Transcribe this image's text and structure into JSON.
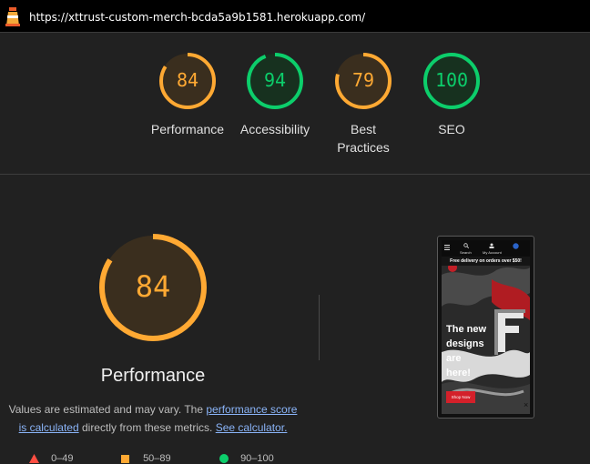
{
  "topbar": {
    "url": "https://xttrust-custom-merch-bcda5a9b1581.herokuapp.com/"
  },
  "colors": {
    "average": "#ffa933",
    "good": "#0cce6b",
    "poor": "#ff4e42"
  },
  "gauges": [
    {
      "score": "84",
      "label": "Performance",
      "status": "average"
    },
    {
      "score": "94",
      "label": "Accessibility",
      "status": "good"
    },
    {
      "score": "79",
      "label_line1": "Best",
      "label_line2": "Practices",
      "status": "average"
    },
    {
      "score": "100",
      "label": "SEO",
      "status": "good"
    }
  ],
  "main": {
    "score": "84",
    "title": "Performance",
    "note_prefix": "Values are estimated and may vary. The ",
    "note_link1_a": "performance score",
    "note_link1_b": "is calculated",
    "note_middle": " directly from these metrics. ",
    "note_link2": "See calculator."
  },
  "legend": [
    {
      "range": "0–49",
      "shape": "triangle-icon"
    },
    {
      "range": "50–89",
      "shape": "square-icon"
    },
    {
      "range": "90–100",
      "shape": "circle-icon"
    }
  ],
  "screenshot": {
    "nav_search": "Search",
    "nav_account": "My Account",
    "banner": "Free delivery on orders over $50!",
    "hero_line1": "The new",
    "hero_line2": "designs",
    "hero_line3": "are",
    "hero_line4": "here!",
    "cta": "Shop Now",
    "close": "×"
  }
}
